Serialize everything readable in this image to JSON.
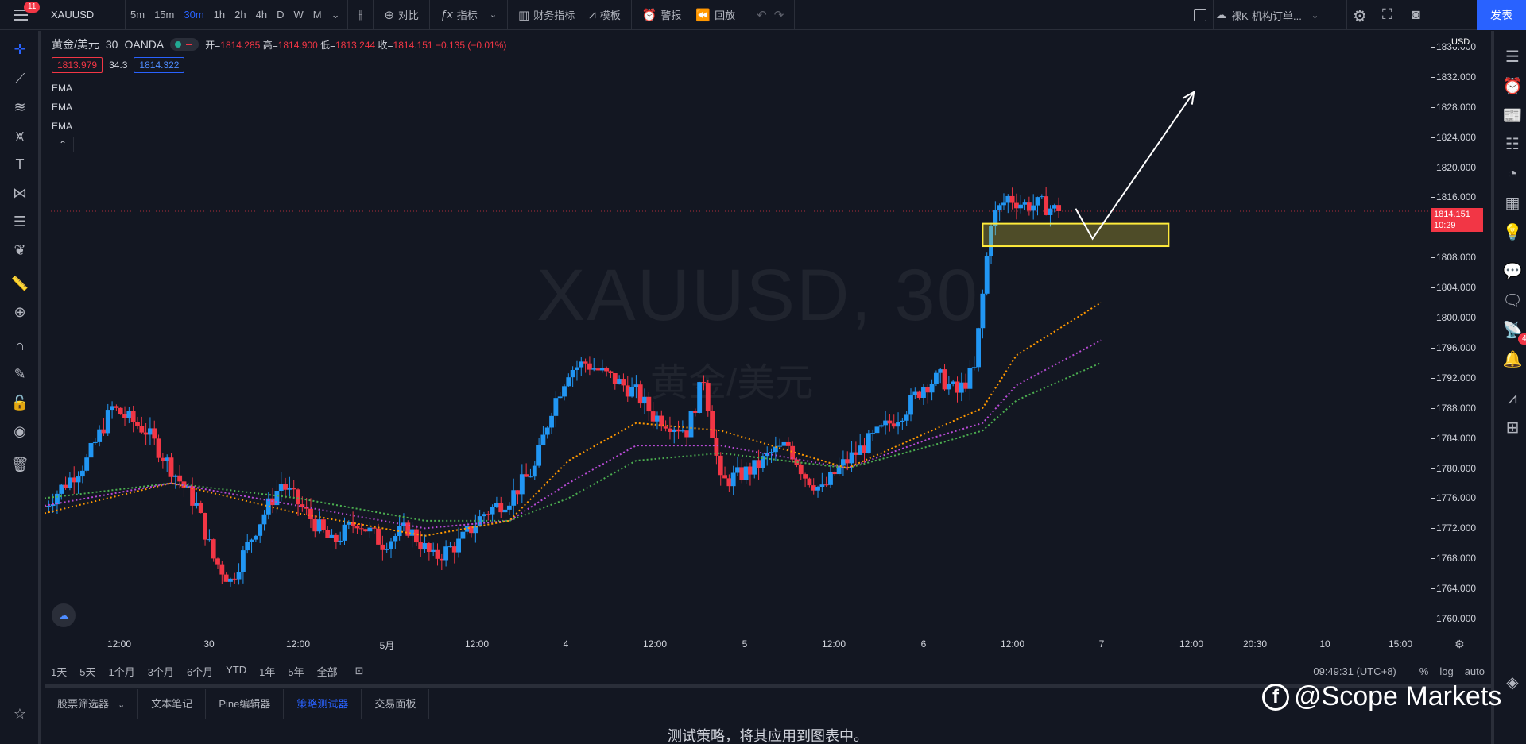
{
  "topbar": {
    "menu_badge": "11",
    "symbol": "XAUUSD",
    "intervals": [
      "5m",
      "15m",
      "30m",
      "1h",
      "2h",
      "4h",
      "D",
      "W",
      "M"
    ],
    "active_interval": "30m",
    "compare_label": "对比",
    "indicators_label": "指标",
    "financials_label": "财务指标",
    "templates_label": "模板",
    "alerts_label": "警报",
    "replay_label": "回放",
    "layout_name": "裸K-机构订单...",
    "publish_label": "发表"
  },
  "legend": {
    "title": "黄金/美元",
    "interval": "30",
    "source": "OANDA",
    "open_label": "开=",
    "open": "1814.285",
    "high_label": "高=",
    "high": "1814.900",
    "low_label": "低=",
    "low": "1813.244",
    "close_label": "收=",
    "close": "1814.151",
    "change": "−0.135 (−0.01%)",
    "bid": "1813.979",
    "spread": "34.3",
    "ask": "1814.322",
    "indicators": [
      "EMA",
      "EMA",
      "EMA"
    ]
  },
  "watermark": {
    "line1": "XAUUSD, 30",
    "line2": "黄金/美元"
  },
  "price_scale": {
    "currency": "USD",
    "labels": [
      "1836.000",
      "1832.000",
      "1828.000",
      "1824.000",
      "1820.000",
      "1816.000",
      "1812.000",
      "1808.000",
      "1804.000",
      "1800.000",
      "1796.000",
      "1792.000",
      "1788.000",
      "1784.000",
      "1780.000",
      "1776.000",
      "1772.000",
      "1768.000",
      "1764.000",
      "1760.000"
    ],
    "current_price": "1814.151",
    "countdown": "10:29"
  },
  "time_axis": {
    "labels": [
      "12:00",
      "30",
      "12:00",
      "5月",
      "12:00",
      "4",
      "12:00",
      "5",
      "12:00",
      "6",
      "12:00",
      "7",
      "12:00",
      "20:30",
      "10",
      "15:00"
    ]
  },
  "rangebar": {
    "ranges": [
      "1天",
      "5天",
      "1个月",
      "3个月",
      "6个月",
      "YTD",
      "1年",
      "5年",
      "全部"
    ],
    "clock": "09:49:31 (UTC+8)",
    "percent": "%",
    "log": "log",
    "auto": "auto"
  },
  "bottom_tabs": {
    "tabs": [
      "股票筛选器",
      "文本笔记",
      "Pine编辑器",
      "策略测试器",
      "交易面板"
    ],
    "active": "策略测试器",
    "message": "测试策略，将其应用到图表中。"
  },
  "brand_watermark": "@Scope Markets",
  "right_badge": "4",
  "chart_data": {
    "type": "candlestick",
    "symbol": "XAUUSD",
    "interval": "30",
    "ylim": [
      1758,
      1838
    ],
    "colors": {
      "up": "#2196f3",
      "down": "#f23645",
      "ema_fast": "#ff9800",
      "ema_mid": "#b84bd6",
      "ema_slow": "#4caf50",
      "zone": "#ffeb3b"
    },
    "price_path": [
      [
        0,
        1775
      ],
      [
        5,
        1781
      ],
      [
        8,
        1788
      ],
      [
        12,
        1785
      ],
      [
        15,
        1780
      ],
      [
        18,
        1775
      ],
      [
        20,
        1768
      ],
      [
        22,
        1765
      ],
      [
        25,
        1772
      ],
      [
        28,
        1778
      ],
      [
        31,
        1774
      ],
      [
        34,
        1770
      ],
      [
        37,
        1773
      ],
      [
        40,
        1770
      ],
      [
        43,
        1772
      ],
      [
        46,
        1768
      ],
      [
        49,
        1770
      ],
      [
        52,
        1774
      ],
      [
        55,
        1776
      ],
      [
        58,
        1780
      ],
      [
        60,
        1788
      ],
      [
        62,
        1793
      ],
      [
        64,
        1794
      ],
      [
        67,
        1792
      ],
      [
        70,
        1790
      ],
      [
        72,
        1787
      ],
      [
        74,
        1786
      ],
      [
        76,
        1785
      ],
      [
        78,
        1792
      ],
      [
        80,
        1778
      ],
      [
        82,
        1779
      ],
      [
        84,
        1780
      ],
      [
        86,
        1782
      ],
      [
        88,
        1783
      ],
      [
        90,
        1779
      ],
      [
        92,
        1777
      ],
      [
        94,
        1780
      ],
      [
        96,
        1782
      ],
      [
        98,
        1784
      ],
      [
        100,
        1786
      ],
      [
        102,
        1788
      ],
      [
        104,
        1791
      ],
      [
        106,
        1792
      ],
      [
        108,
        1790
      ],
      [
        110,
        1793
      ],
      [
        112,
        1813
      ],
      [
        114,
        1816
      ],
      [
        116,
        1815
      ],
      [
        118,
        1815
      ],
      [
        120,
        1814.151
      ]
    ],
    "ema_fast": [
      [
        0,
        1774
      ],
      [
        15,
        1778
      ],
      [
        30,
        1774
      ],
      [
        45,
        1771
      ],
      [
        55,
        1773
      ],
      [
        62,
        1781
      ],
      [
        70,
        1786
      ],
      [
        80,
        1785
      ],
      [
        95,
        1780
      ],
      [
        105,
        1785
      ],
      [
        111,
        1788
      ],
      [
        115,
        1795
      ],
      [
        125,
        1802
      ]
    ],
    "ema_mid": [
      [
        0,
        1775
      ],
      [
        15,
        1778
      ],
      [
        30,
        1775
      ],
      [
        45,
        1772
      ],
      [
        55,
        1773
      ],
      [
        62,
        1778
      ],
      [
        70,
        1783
      ],
      [
        80,
        1783
      ],
      [
        95,
        1780
      ],
      [
        105,
        1784
      ],
      [
        111,
        1786
      ],
      [
        115,
        1791
      ],
      [
        125,
        1797
      ]
    ],
    "ema_slow": [
      [
        0,
        1776
      ],
      [
        15,
        1778
      ],
      [
        30,
        1776
      ],
      [
        45,
        1773
      ],
      [
        55,
        1773
      ],
      [
        62,
        1776
      ],
      [
        70,
        1781
      ],
      [
        80,
        1782
      ],
      [
        95,
        1780
      ],
      [
        105,
        1783
      ],
      [
        111,
        1785
      ],
      [
        115,
        1789
      ],
      [
        125,
        1794
      ]
    ],
    "zone": {
      "x0": 111,
      "x1": 133,
      "y0": 1809.5,
      "y1": 1812.5
    },
    "arrow_path": [
      [
        122,
        1814.5
      ],
      [
        124,
        1810.5
      ],
      [
        136,
        1830
      ]
    ],
    "x_range": [
      0,
      164
    ]
  }
}
